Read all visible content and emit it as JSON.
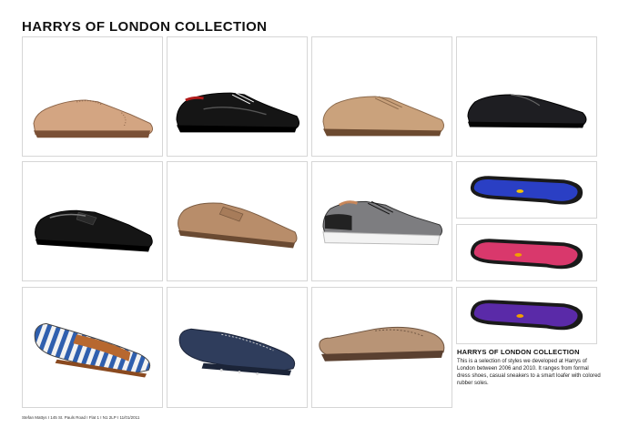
{
  "page": {
    "title": "HARRYS OF LONDON COLLECTION",
    "footer": "Stefan Mattys I 145 St. Pauls Road I Flat 1 I N1 2LP I 11/01/2011"
  },
  "caption": {
    "title": "HARRYS OF LONDON COLLECTION",
    "body": "This is a selection of styles we developed at Harrys of London between 2006 and 2010. It ranges from formal dress shoes, casual sneakers to a smart loafer with colored rubber soles."
  },
  "colors": {
    "tan_suede": "#d3a582",
    "black_leather": "#151515",
    "tan_leather": "#caa27c",
    "navy_suede": "#2f3d5c",
    "blue_sole": "#2a3fc4",
    "pink_sole": "#d9386c",
    "purple_sole": "#5a2aa8"
  }
}
